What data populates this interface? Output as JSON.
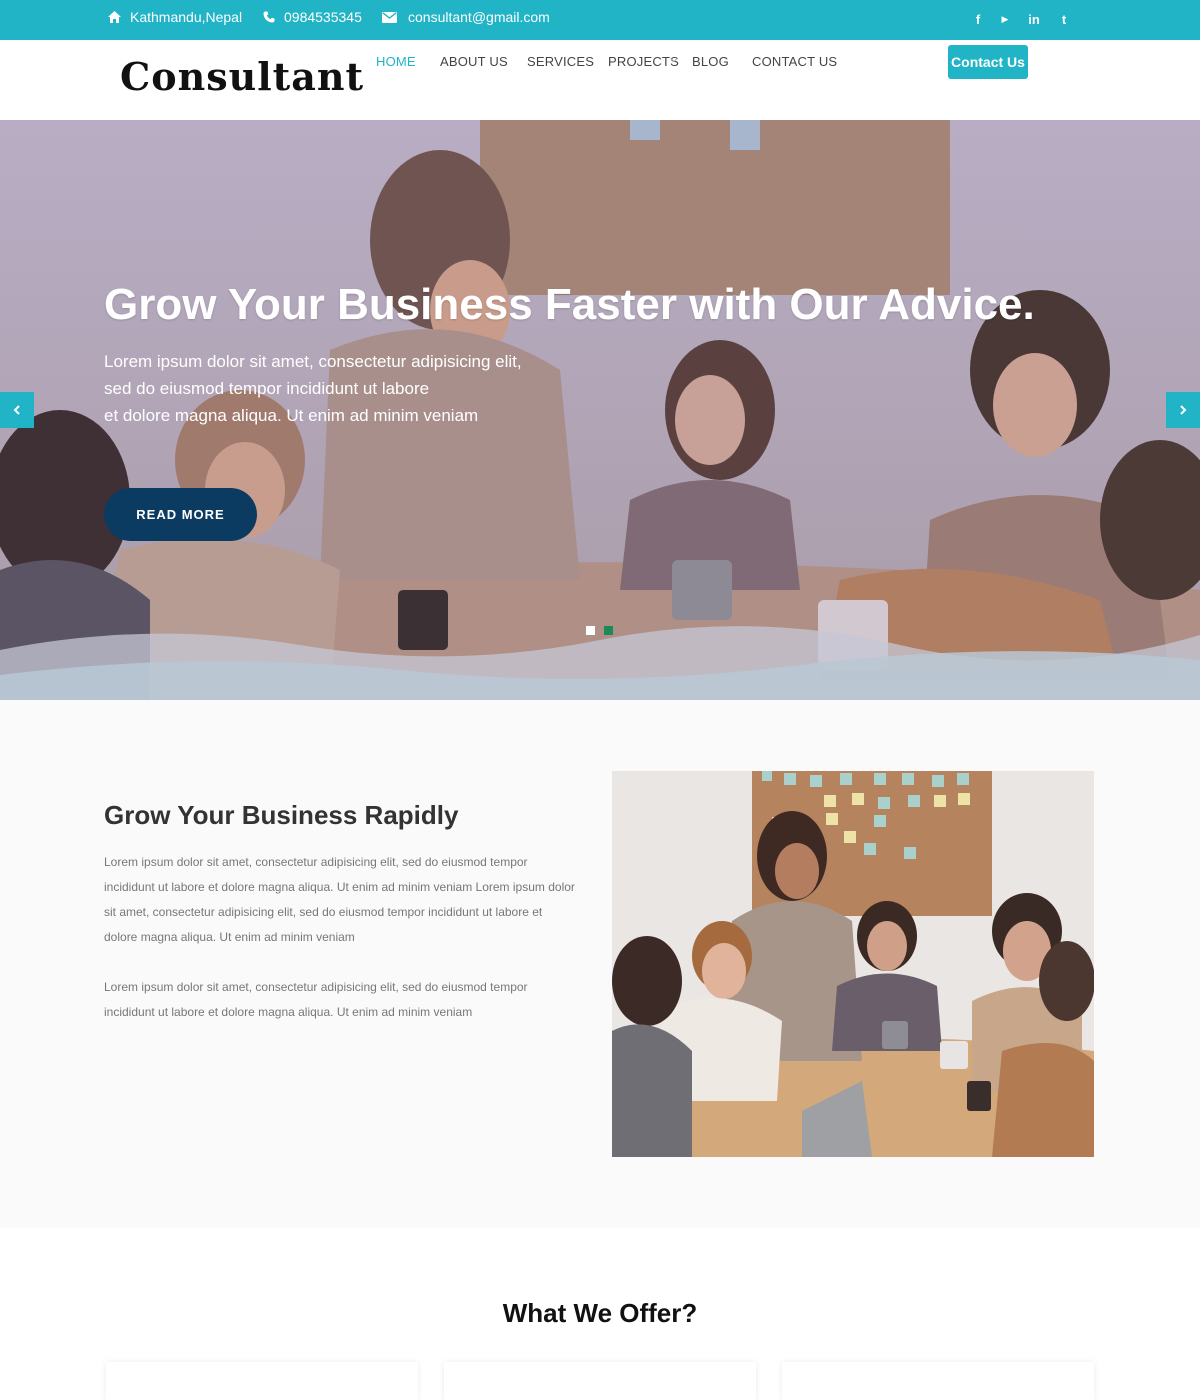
{
  "topbar": {
    "address": "Kathmandu,Nepal",
    "phone": "0984535345",
    "email": "consultant@gmail.com",
    "social": [
      {
        "icon": "facebook-icon",
        "glyph": "f"
      },
      {
        "icon": "youtube-icon",
        "glyph": "▶"
      },
      {
        "icon": "linkedin-icon",
        "glyph": "in"
      },
      {
        "icon": "twitter-icon",
        "glyph": "t"
      }
    ]
  },
  "header": {
    "logo": "Consultant",
    "nav": [
      "HOME",
      "ABOUT US",
      "SERVICES",
      "PROJECTS",
      "BLOG",
      "CONTACT US"
    ],
    "active_nav": "HOME",
    "cta_label": "Contact Us"
  },
  "hero": {
    "title": "Grow Your Business Faster with Our Advice.",
    "text_lines": [
      "Lorem ipsum dolor sit amet, consectetur adipisicing elit,",
      "sed do eiusmod tempor incididunt ut labore",
      "et dolore magna aliqua. Ut enim ad minim veniam"
    ],
    "button_label": "READ MORE",
    "slides": 2,
    "active_slide": 2
  },
  "about": {
    "heading": "Grow Your Business Rapidly",
    "paragraph1_lines": [
      "Lorem ipsum dolor sit amet, consectetur adipisicing elit, sed do eiusmod tempor",
      "incididunt ut labore et dolore magna aliqua. Ut enim ad minim veniam Lorem ipsum dolor",
      "sit amet, consectetur adipisicing elit, sed do eiusmod tempor incididunt ut labore et",
      "dolore magna aliqua. Ut enim ad minim veniam"
    ],
    "paragraph2_lines": [
      "Lorem ipsum dolor sit amet, consectetur adipisicing elit, sed do eiusmod tempor",
      "incididunt ut labore et dolore magna aliqua. Ut enim ad minim veniam"
    ]
  },
  "offer": {
    "title": "What We Offer?"
  },
  "colors": {
    "accent": "#20b4c6",
    "button_dark": "#0c3b62",
    "active_dot": "#1a8a5a"
  }
}
